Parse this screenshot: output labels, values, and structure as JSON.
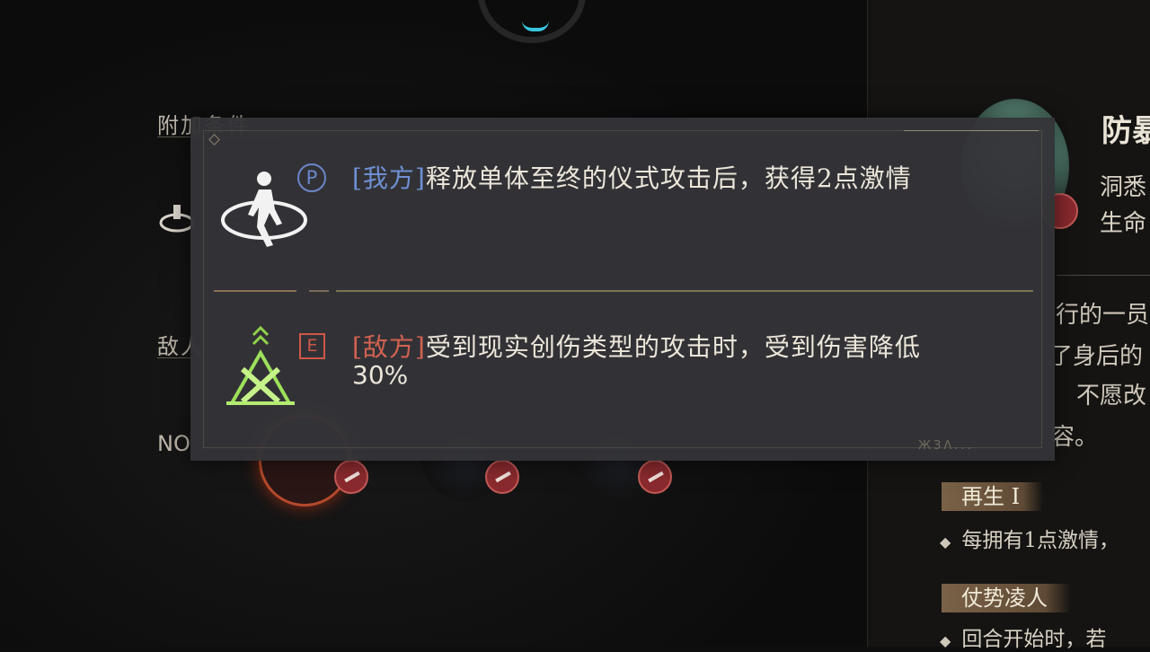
{
  "left": {
    "label_condition": "附加条件",
    "label_enemy": "敌人",
    "no_text": "NO"
  },
  "right": {
    "title": "防暴",
    "sub1": "洞悉",
    "sub2": "生命",
    "body1": "行的一员",
    "body2": "了身后的",
    "body3": "不愿改",
    "body4": "容。",
    "tag1": "再生 I",
    "bullet1": "每拥有1点激情，",
    "tag2": "仗势凌人",
    "bullet2": "回合开始时，若"
  },
  "tooltip": {
    "entries": [
      {
        "icon": "walking-figure-icon",
        "type_letter": "P",
        "tag": "[我方]",
        "text": "释放单体至终的仪式攻击后，获得2点激情",
        "tag_color": "#6f8fd2"
      },
      {
        "icon": "green-spike-trap-icon",
        "type_letter": "E",
        "tag": "[敌方]",
        "text": "受到现实创伤类型的攻击时，受到伤害降低",
        "text_line2": "30%",
        "tag_color": "#d26252"
      }
    ],
    "footer_mark": "ЖЗΛ..."
  },
  "colors": {
    "accent_cyan": "#38c6dc",
    "tooltip_bg": "#343438",
    "ally_blue": "#6f8fd2",
    "enemy_red": "#d26252"
  }
}
